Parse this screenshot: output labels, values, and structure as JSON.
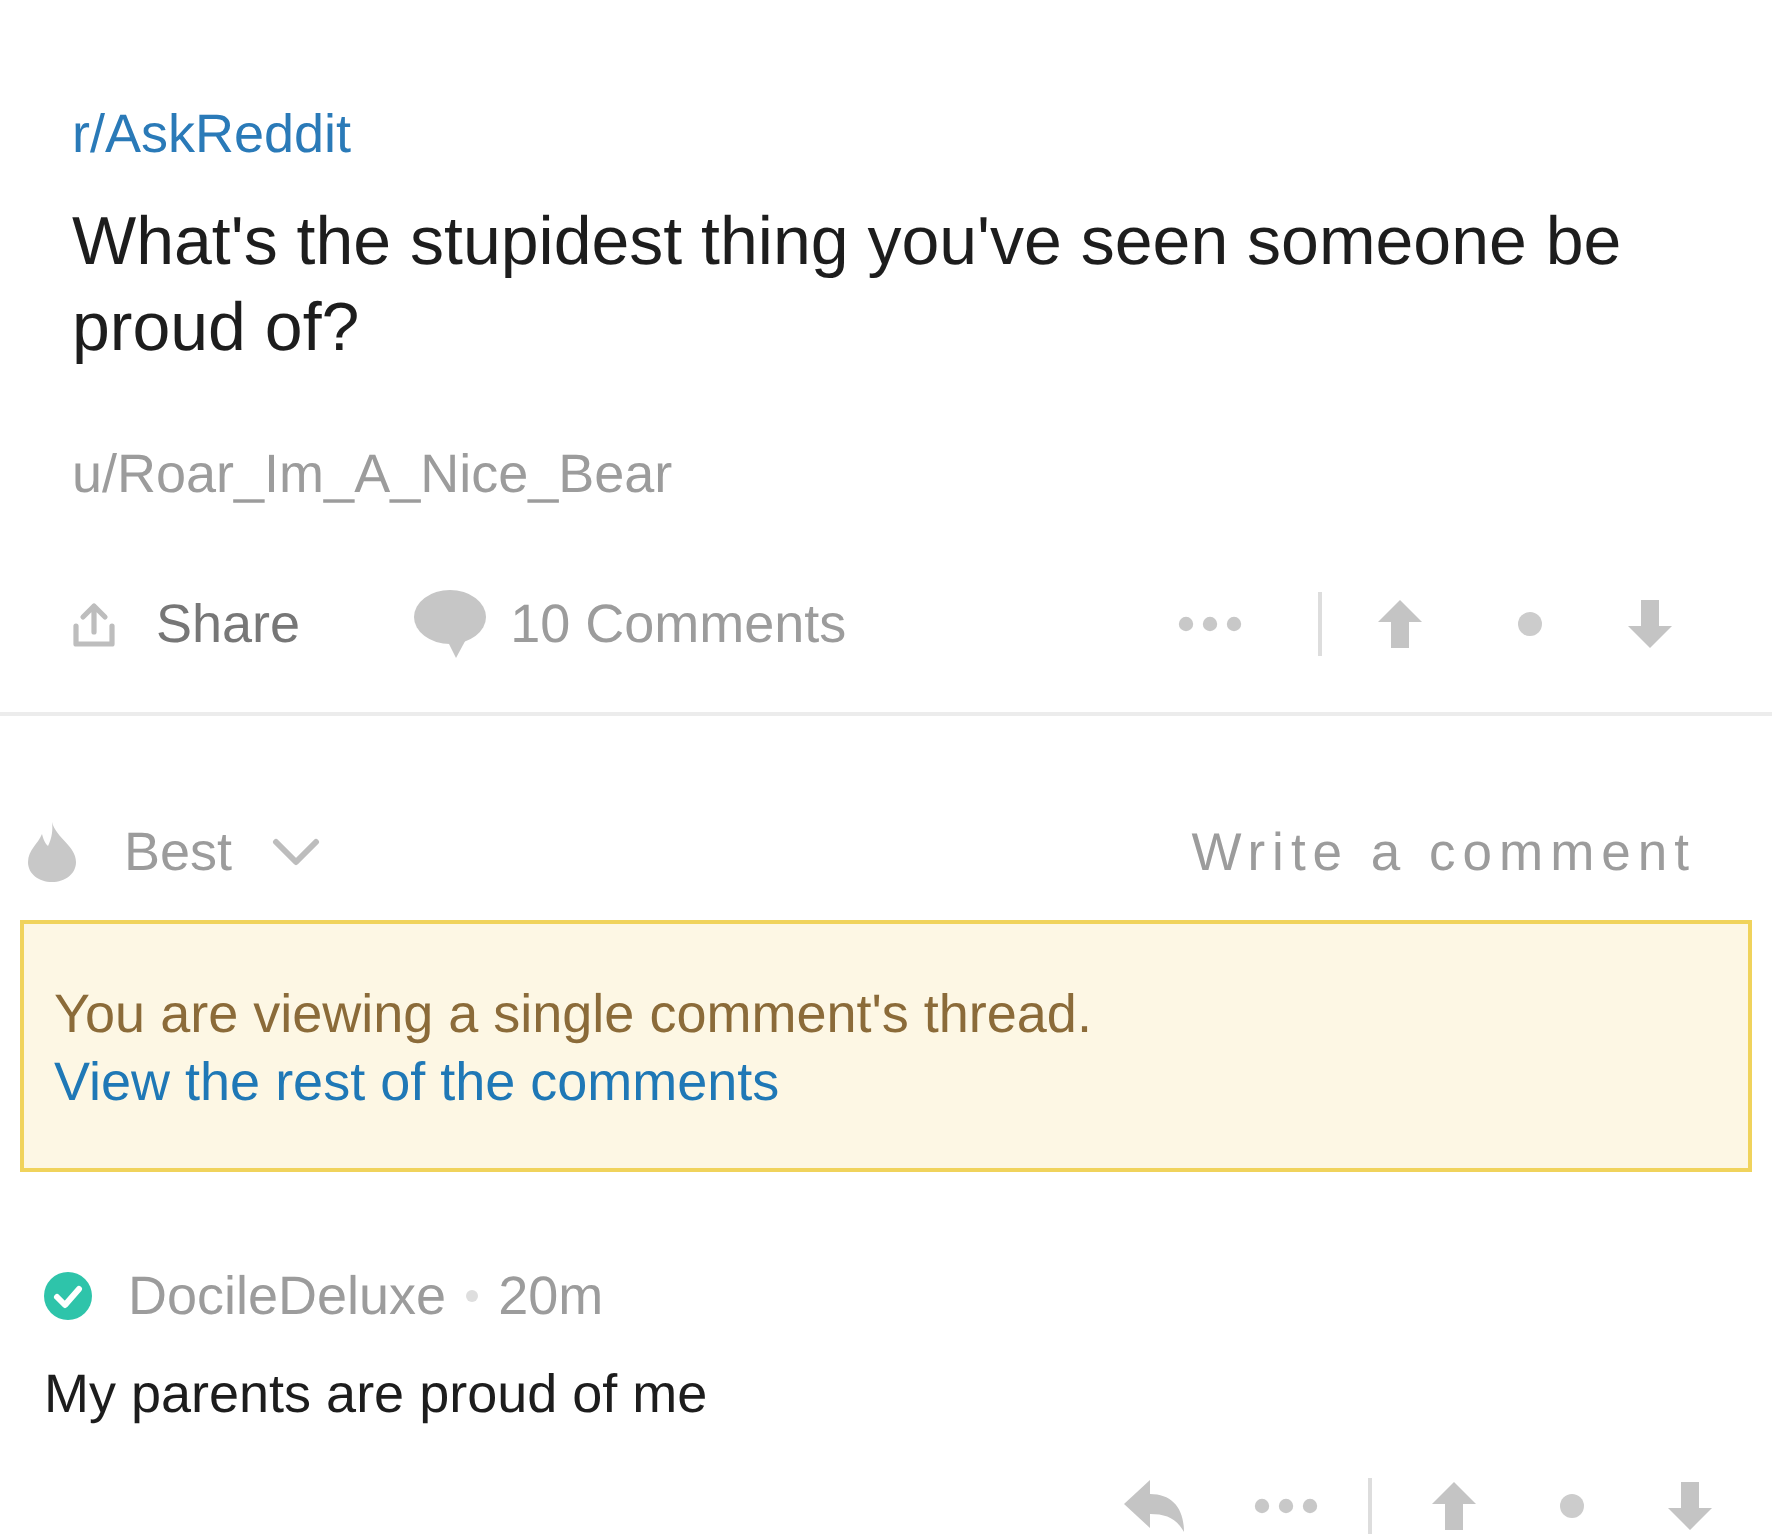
{
  "post": {
    "subreddit": "r/AskReddit",
    "title": "What's the stupidest thing you've seen someone be proud of?",
    "author": "u/Roar_Im_A_Nice_Bear"
  },
  "post_actions": {
    "share": "Share",
    "comments": "10 Comments"
  },
  "comment_bar": {
    "sort": "Best",
    "write_comment": "Write a comment"
  },
  "notice": {
    "text": "You are viewing a single comment's thread.",
    "link": "View the rest of the comments"
  },
  "comment": {
    "author": "DocileDeluxe",
    "verified": true,
    "time": "20m",
    "body": "My parents are proud of me"
  }
}
